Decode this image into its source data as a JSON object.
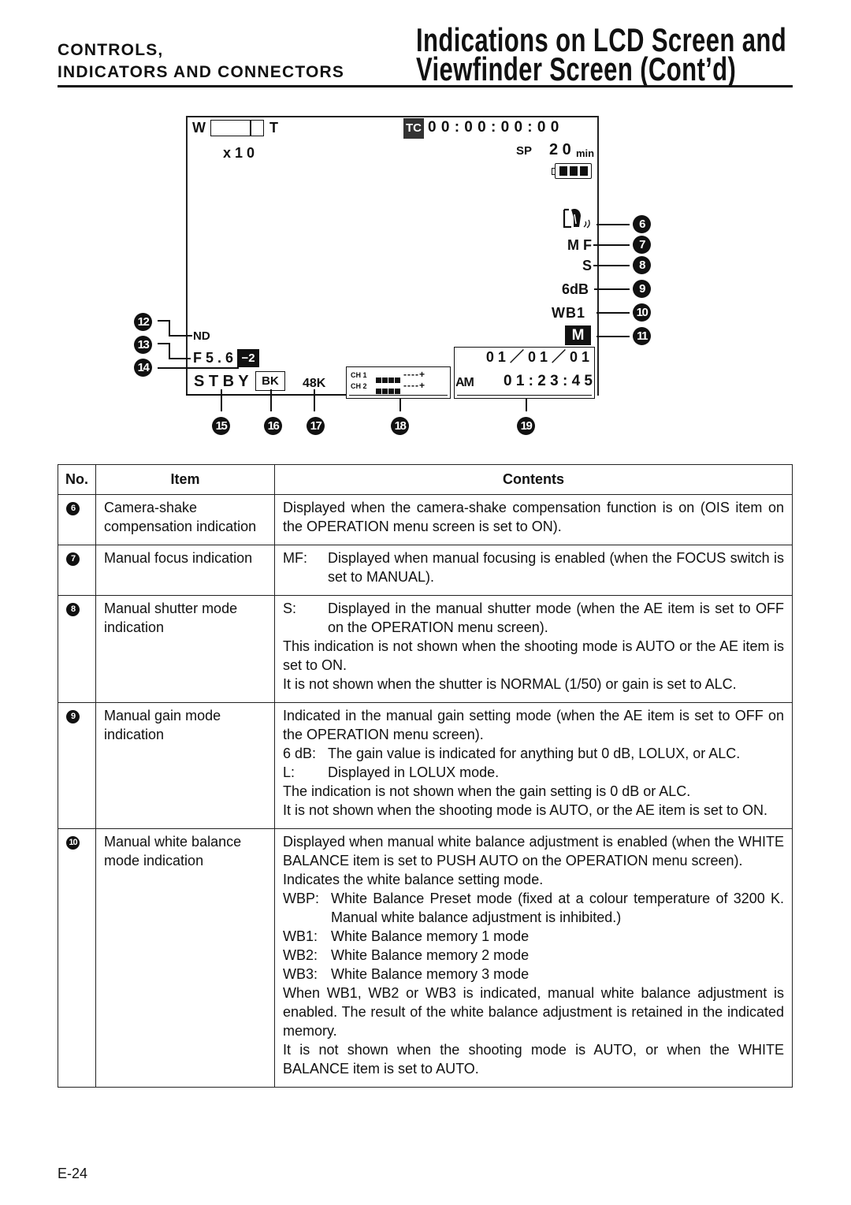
{
  "header": {
    "section_line1": "CONTROLS,",
    "section_line2": "INDICATORS AND CONNECTORS",
    "title_line1": "Indications on LCD Screen and",
    "title_line2": "Viewfinder Screen (Cont’d)"
  },
  "screen": {
    "zoom_w": "W",
    "zoom_t": "T",
    "zoom_level": "x 1 0",
    "tc_badge": "TC",
    "timecode": "0 0 : 0 0 : 0 0 : 0 0",
    "tape_speed": "SP",
    "remaining": "2 0",
    "remaining_unit": "min",
    "battery_level": 1.0,
    "mf": "M F",
    "shutter": "S",
    "gain": "6dB",
    "wb": "WB1",
    "mem": "M",
    "nd": "ND",
    "iris": "F 5 . 6",
    "ae_level": "−2",
    "status": "S T B Y",
    "bk": "BK",
    "audio_freq": "48K",
    "ch1": "CH 1",
    "ch2": "CH 2",
    "meter_scale": "----+",
    "date": "0 1 ／ 0 1 ／ 0 1",
    "ampm": "AM",
    "time": "0 1 : 2 3 : 4 5",
    "callouts_right": [
      "6",
      "7",
      "8",
      "9",
      "10",
      "11"
    ],
    "callouts_left": [
      "12",
      "13",
      "14"
    ],
    "callouts_bottom": [
      "15",
      "16",
      "17",
      "18",
      "19"
    ]
  },
  "table": {
    "headers": [
      "No.",
      "Item",
      "Contents"
    ],
    "rows": [
      {
        "no": "6",
        "item": "Camera-shake compensation indication",
        "contents": [
          {
            "label": "",
            "text": "Displayed when the camera-shake compensation function is on (OIS item on the OPERATION menu screen is set to ON)."
          }
        ]
      },
      {
        "no": "7",
        "item": "Manual focus indication",
        "contents": [
          {
            "label": "MF:",
            "text": "Displayed when manual focusing is enabled (when the FOCUS switch is set to MANUAL)."
          }
        ]
      },
      {
        "no": "8",
        "item": "Manual shutter mode indication",
        "contents": [
          {
            "label": "S:",
            "text": "Displayed in the manual shutter mode (when the AE item is set to OFF on the OPERATION menu screen)."
          },
          {
            "label": "",
            "text": "This indication is not shown when the shooting mode is AUTO or the AE item is set to ON."
          },
          {
            "label": "",
            "text": "It is not shown when the shutter is NORMAL (1/50) or gain is set to ALC."
          }
        ]
      },
      {
        "no": "9",
        "item": "Manual gain mode indication",
        "contents": [
          {
            "label": "",
            "text": "Indicated in the manual gain setting mode (when the AE item is set to OFF on the OPERATION menu screen)."
          },
          {
            "label": "6 dB:",
            "text": "The gain value is indicated for anything but 0 dB, LOLUX, or ALC."
          },
          {
            "label": "L:",
            "text": "Displayed in LOLUX mode."
          },
          {
            "label": "",
            "text": "The indication is not shown when the gain setting is 0 dB or ALC."
          },
          {
            "label": "",
            "text": "It is not shown when the shooting mode is AUTO, or the AE item is set to ON."
          }
        ]
      },
      {
        "no": "10",
        "item": "Manual white balance mode indication",
        "contents": [
          {
            "label": "",
            "text": "Displayed when manual white balance adjustment is enabled (when the WHITE BALANCE item is set to PUSH AUTO on the OPERATION menu screen)."
          },
          {
            "label": "",
            "text": "Indicates the white balance setting mode."
          },
          {
            "label": "WBP:",
            "text": "White Balance Preset mode (fixed at a colour temperature of 3200 K. Manual white balance adjustment is inhibited.)"
          },
          {
            "label": "WB1:",
            "text": "White Balance memory 1 mode"
          },
          {
            "label": "WB2:",
            "text": "White Balance memory 2 mode"
          },
          {
            "label": "WB3:",
            "text": "White Balance memory 3 mode"
          },
          {
            "label": "",
            "text": "When WB1, WB2 or WB3 is indicated, manual white balance adjustment is enabled. The result of the white balance adjustment is retained in the indicated memory."
          },
          {
            "label": "",
            "text": "It is not shown when the shooting mode is AUTO, or when the WHITE BALANCE item is set to AUTO."
          }
        ]
      }
    ]
  },
  "footer": {
    "page": "E-24"
  }
}
